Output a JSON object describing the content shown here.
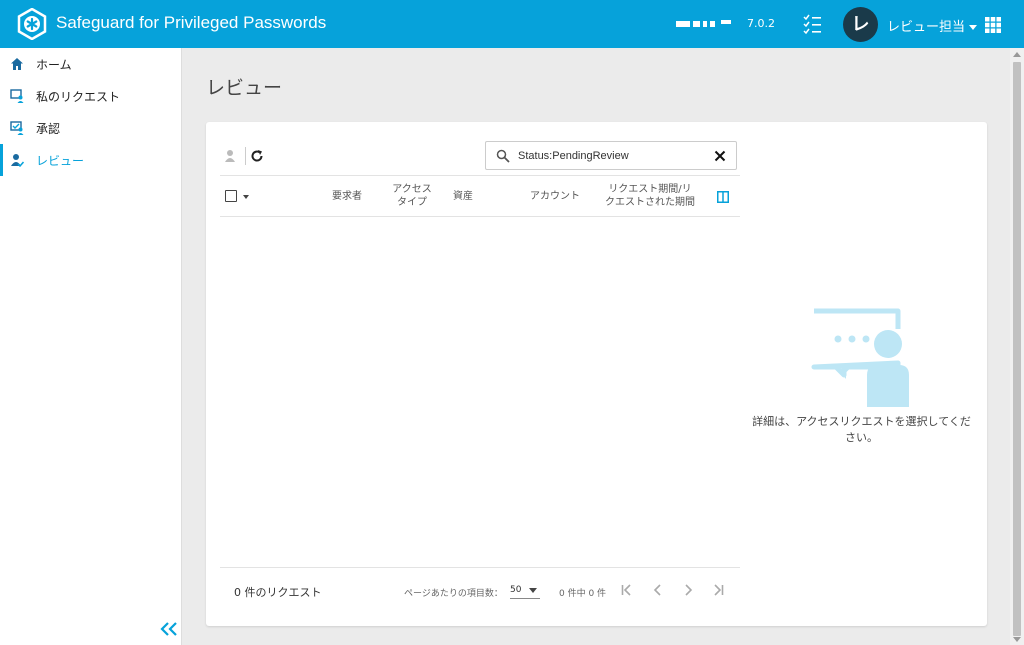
{
  "header": {
    "app_title": "Safeguard for Privileged Passwords",
    "version": "7.0.2",
    "avatar_letter": "レ",
    "user_label": "レビュー担当",
    "brand_color": "#06a2da"
  },
  "sidebar": {
    "items": [
      {
        "label": "ホーム",
        "icon": "home-icon"
      },
      {
        "label": "私のリクエスト",
        "icon": "my-requests-icon"
      },
      {
        "label": "承認",
        "icon": "approvals-icon"
      },
      {
        "label": "レビュー",
        "icon": "review-icon",
        "active": true
      }
    ]
  },
  "main": {
    "page_title": "レビュー",
    "search": {
      "value": "Status:PendingReview",
      "placeholder": ""
    },
    "columns": [
      "要求者",
      "アクセス\nタイプ",
      "資産",
      "アカウント",
      "リクエスト期間/リ\nクエストされた期間"
    ],
    "footer": {
      "request_count": "0 件のリクエスト",
      "per_page_label": "ページあたりの項目数：",
      "per_page_value": "50",
      "range": "0 件中 0 件"
    },
    "empty_message": "詳細は、アクセスリクエストを選択してください。"
  }
}
